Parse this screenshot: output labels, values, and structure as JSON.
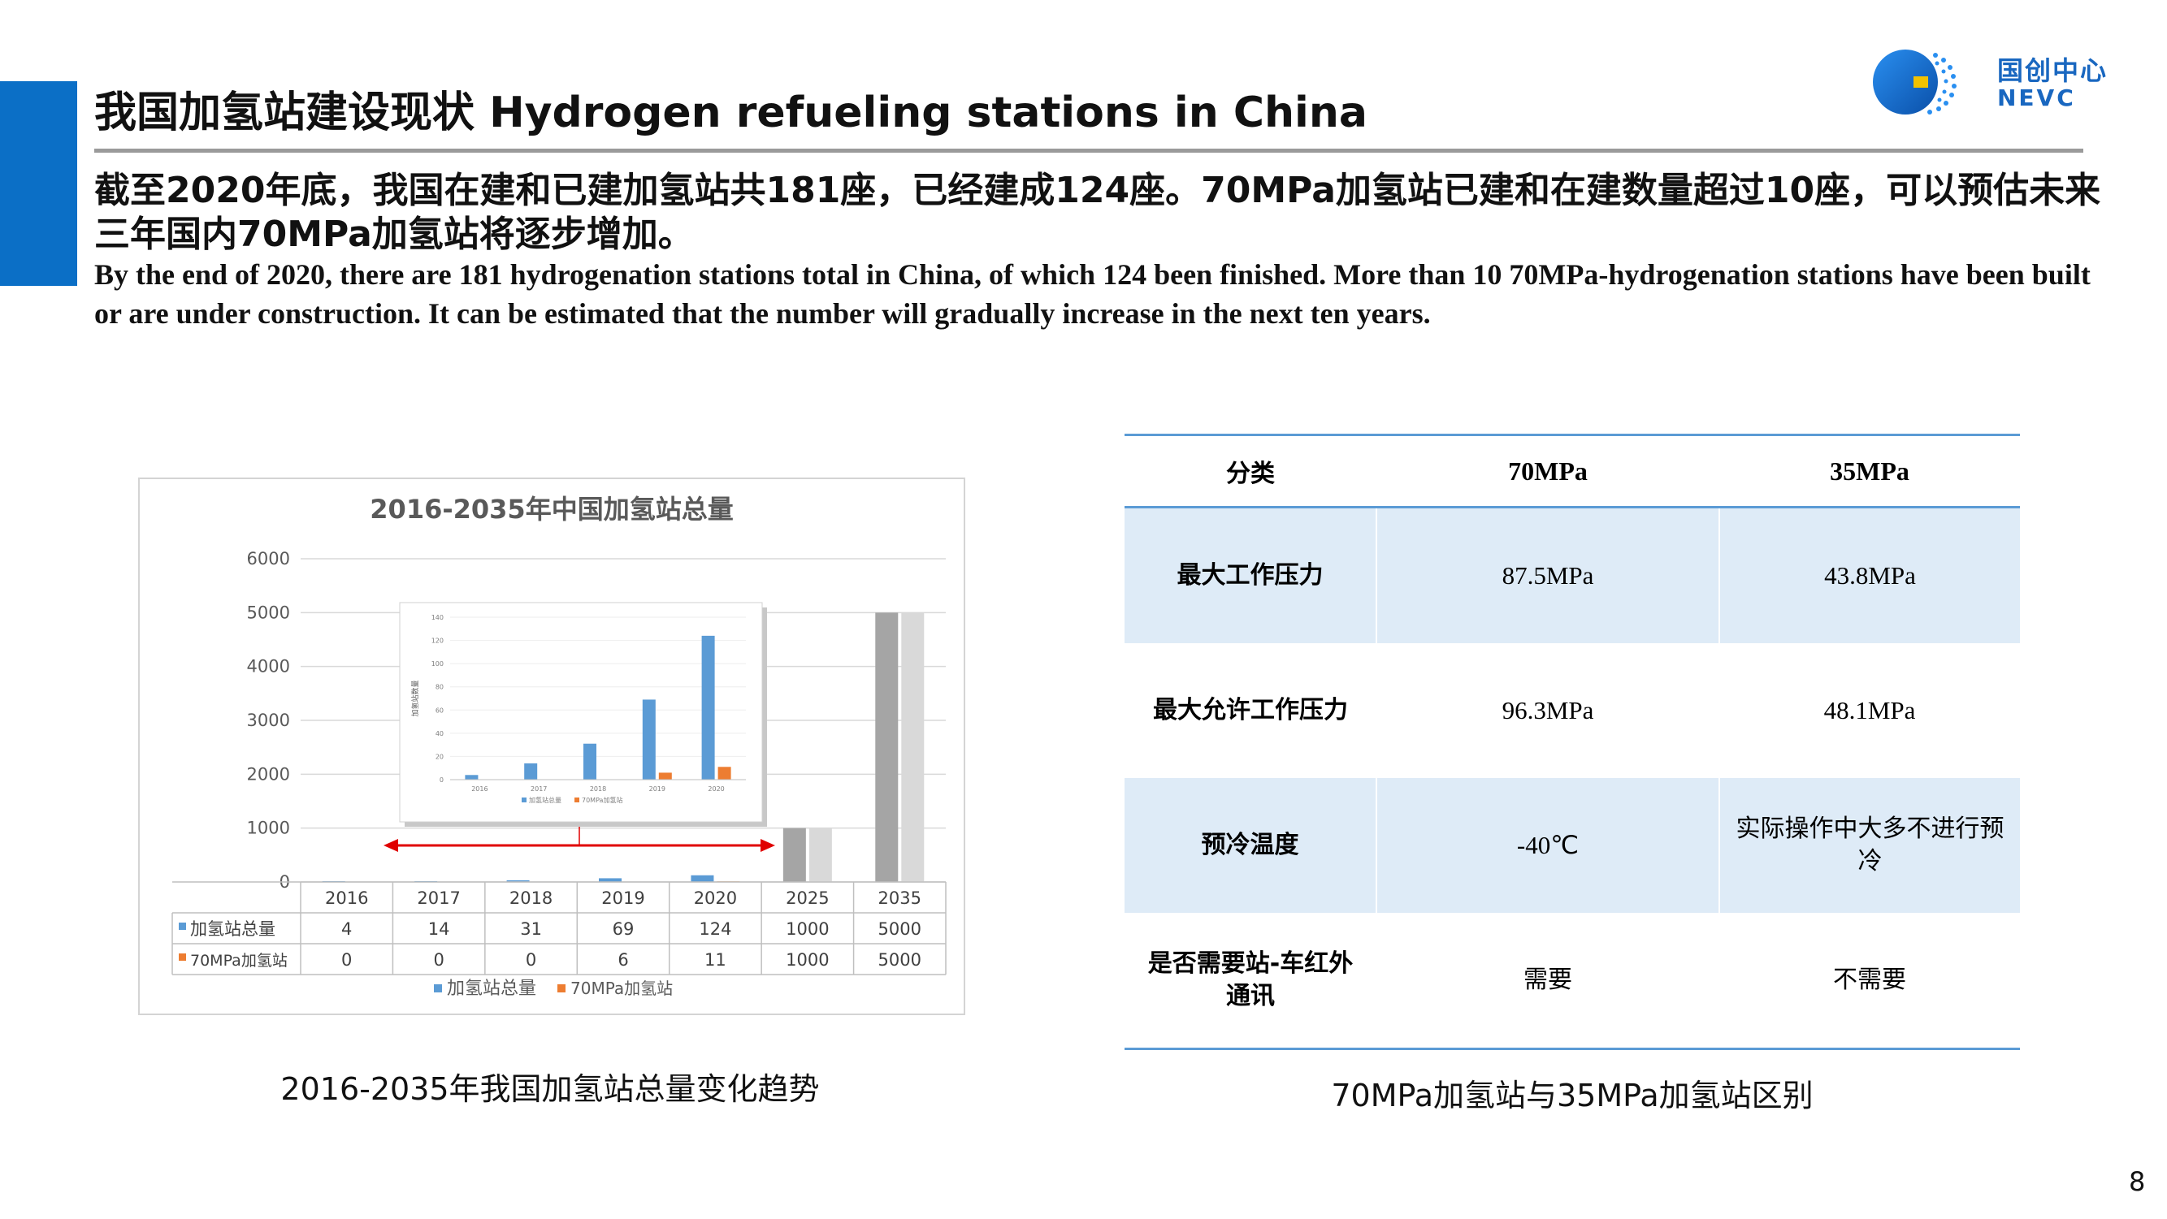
{
  "header": {
    "title": "我国加氢站建设现状 Hydrogen refueling stations in China",
    "logo_cn": "国创中心",
    "logo_en": "NEVC"
  },
  "summary": {
    "cn": "截至2020年底，我国在建和已建加氢站共181座，已经建成124座。70MPa加氢站已建和在建数量超过10座，可以预估未来三年国内70MPa加氢站将逐步增加。",
    "en": "By the end of 2020, there are 181 hydrogenation stations total in China, of which 124 been finished. More than 10 70MPa-hydrogenation stations have been built or are under construction. It can be estimated that the number will gradually increase in the next ten years."
  },
  "chart_data": [
    {
      "type": "bar",
      "title": "2016-2035年中国加氢站总量",
      "categories": [
        "2016",
        "2017",
        "2018",
        "2019",
        "2020",
        "2025",
        "2035"
      ],
      "series": [
        {
          "name": "加氢站总量",
          "values": [
            4,
            14,
            31,
            69,
            124,
            1000,
            5000
          ]
        },
        {
          "name": "70MPa加氢站",
          "values": [
            0,
            0,
            0,
            6,
            11,
            1000,
            5000
          ]
        }
      ],
      "ylim": [
        0,
        6000
      ],
      "yticks": [
        0,
        1000,
        2000,
        3000,
        4000,
        5000,
        6000
      ],
      "data_table": true,
      "legend": "bottom",
      "grid": true,
      "colors": {
        "total": "#5b9bd5",
        "mpa70": "#ed7d31",
        "projected": "#a5a5a5"
      }
    },
    {
      "type": "bar",
      "title": "",
      "categories": [
        "2016",
        "2017",
        "2018",
        "2019",
        "2020"
      ],
      "series": [
        {
          "name": "加氢站总量",
          "values": [
            4,
            14,
            31,
            69,
            124
          ]
        },
        {
          "name": "70MPa加氢站",
          "values": [
            0,
            0,
            0,
            6,
            11
          ]
        }
      ],
      "ylabel": "加氢站数量",
      "ylim": [
        0,
        140
      ],
      "yticks": [
        0,
        20,
        40,
        60,
        80,
        100,
        120,
        140
      ],
      "legend": "bottom",
      "grid": true,
      "inset": true
    }
  ],
  "chart_caption": "2016-2035年我国加氢站总量变化趋势",
  "comparison": {
    "headers": [
      "分类",
      "70MPa",
      "35MPa"
    ],
    "rows": [
      {
        "label": "最大工作压力",
        "v70": "87.5MPa",
        "v35": "43.8MPa"
      },
      {
        "label": "最大允许工作压力",
        "v70": "96.3MPa",
        "v35": "48.1MPa"
      },
      {
        "label": "预冷温度",
        "v70": "-40℃",
        "v35": "实际操作中大多不进行预冷"
      },
      {
        "label": "是否需要站-车红外通讯",
        "v70": "需要",
        "v35": "不需要"
      }
    ],
    "caption": "70MPa加氢站与35MPa加氢站区别"
  },
  "page_number": "8"
}
